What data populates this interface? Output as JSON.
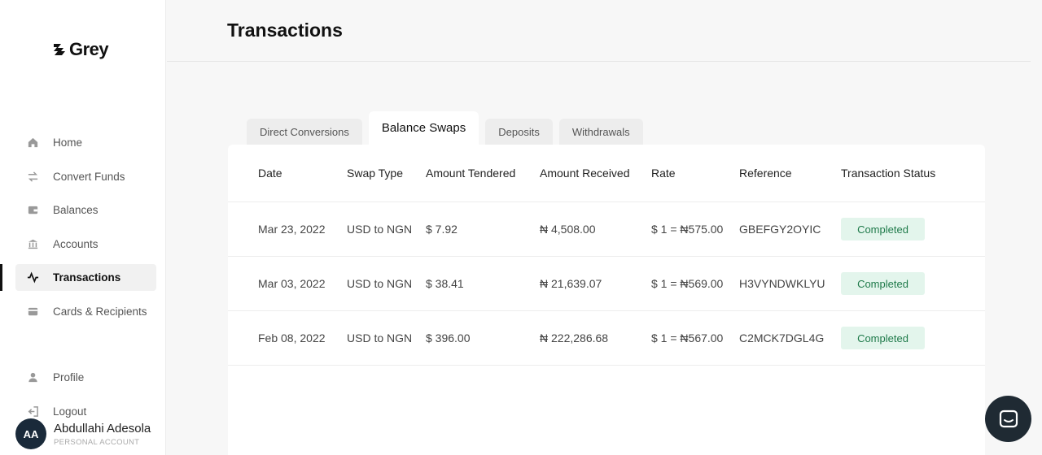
{
  "app": {
    "logo_text": "Grey"
  },
  "sidebar": {
    "items": [
      {
        "label": "Home",
        "icon": "home-icon"
      },
      {
        "label": "Convert Funds",
        "icon": "swap-arrows-icon"
      },
      {
        "label": "Balances",
        "icon": "wallet-icon"
      },
      {
        "label": "Accounts",
        "icon": "bank-icon"
      },
      {
        "label": "Transactions",
        "icon": "activity-icon",
        "active": true
      },
      {
        "label": "Cards & Recipients",
        "icon": "card-icon"
      }
    ],
    "bottom_items": [
      {
        "label": "Profile",
        "icon": "user-icon"
      },
      {
        "label": "Logout",
        "icon": "logout-icon"
      }
    ],
    "user": {
      "initials": "AA",
      "name": "Abdullahi Adesola",
      "account_type": "PERSONAL ACCOUNT"
    }
  },
  "header": {
    "title": "Transactions"
  },
  "tabs": [
    {
      "label": "Direct Conversions"
    },
    {
      "label": "Balance Swaps",
      "active": true
    },
    {
      "label": "Deposits"
    },
    {
      "label": "Withdrawals"
    }
  ],
  "table": {
    "columns": [
      "Date",
      "Swap Type",
      "Amount Tendered",
      "Amount Received",
      "Rate",
      "Reference",
      "Transaction Status"
    ],
    "rows": [
      [
        "Mar 23, 2022",
        "USD to NGN",
        "$ 7.92",
        "₦ 4,508.00",
        "$ 1 = ₦575.00",
        "GBEFGY2OYIC",
        "Completed"
      ],
      [
        "Mar 03, 2022",
        "USD to NGN",
        "$ 38.41",
        "₦ 21,639.07",
        "$ 1 = ₦569.00",
        "H3VYNDWKLYU",
        "Completed"
      ],
      [
        "Feb 08, 2022",
        "USD to NGN",
        "$ 396.00",
        "₦ 222,286.68",
        "$ 1 = ₦567.00",
        "C2MCK7DGL4G",
        "Completed"
      ]
    ]
  },
  "colors": {
    "status_completed_bg": "#e3f5ec",
    "status_completed_text": "#1f7a4a",
    "chat_button": "#1f2a33"
  }
}
